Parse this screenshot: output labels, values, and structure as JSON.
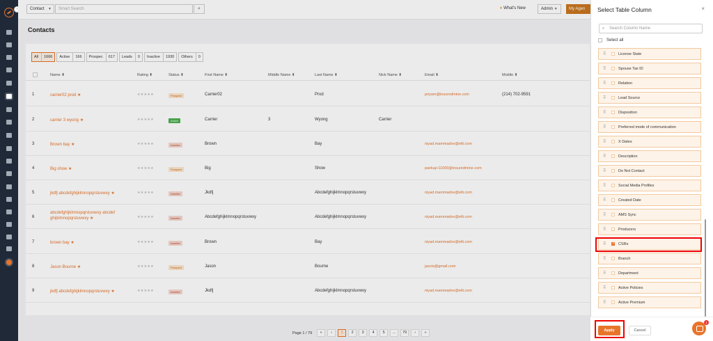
{
  "topbar": {
    "entity_select": "Contact",
    "search_placeholder": "Smart Search",
    "whats_new": "What's New",
    "role_select": "Admin",
    "agency_button": "My Agen"
  },
  "page": {
    "title": "Contacts"
  },
  "filters": [
    {
      "label": "All",
      "count": "1666"
    },
    {
      "label": "Active",
      "count": "166"
    },
    {
      "label": "Prospec",
      "count": "617"
    },
    {
      "label": "Leads",
      "count": "0"
    },
    {
      "label": "Inactive",
      "count": "1930"
    },
    {
      "label": "Others",
      "count": "0"
    }
  ],
  "table": {
    "headers": {
      "name": "Name ⬍",
      "rating": "Rating ⬍",
      "status": "Status ⬍",
      "first": "First Name ⬍",
      "middle": "Middle Name ⬍",
      "last": "Last Name ⬍",
      "nick": "Nick Name ⬍",
      "email": "Email ⬍",
      "mobile": "Mobile ⬍"
    },
    "rows": [
      {
        "num": "1",
        "name": "carrier02 prod",
        "rating": "★★★★★",
        "status": "Prospect",
        "first": "Carrier02",
        "middle": "",
        "last": "Prod",
        "nick": "",
        "email": "priyam@insuredmine.com",
        "mobile": "(214) 702-9591"
      },
      {
        "num": "2",
        "name": "carrier 3 wyong",
        "rating": "★★★★★",
        "status": "Active",
        "first": "Carrier",
        "middle": "3",
        "last": "Wyong",
        "nick": "Carrier",
        "email": "",
        "mobile": ""
      },
      {
        "num": "3",
        "name": "Brown bay",
        "rating": "★★★★★",
        "status": "Inactive",
        "first": "Brown",
        "middle": "",
        "last": "Bay",
        "nick": "",
        "email": "niyad.mammadov@elti.com",
        "mobile": ""
      },
      {
        "num": "4",
        "name": "Big show",
        "rating": "★★★★★",
        "status": "Prospect",
        "first": "Big",
        "middle": "",
        "last": "Show",
        "nick": "",
        "email": "pankaj+11000@insuredmine.com",
        "mobile": ""
      },
      {
        "num": "5",
        "name": "jkdfj abcdefghijklmnopqrstuvwxy",
        "rating": "★★★★★",
        "status": "Inactive",
        "first": "Jkdfj",
        "middle": "",
        "last": "Abcdefghijklmnopqrstuvwxy",
        "nick": "",
        "email": "niyad.mammadov@elti.com",
        "mobile": ""
      },
      {
        "num": "6",
        "name": "abcdefghijklmnopqrstuvwxy abcdef ghijklmnopqrstuvwxy",
        "rating": "★★★★★",
        "status": "Inactive",
        "first": "Abcdefghijklmnopqrstuvwxy",
        "middle": "",
        "last": "Abcdefghijklmnopqrstuvwxy",
        "nick": "",
        "email": "niyad.mammadov@elti.com",
        "mobile": ""
      },
      {
        "num": "7",
        "name": "brown bay",
        "rating": "★★★★★",
        "status": "Inactive",
        "first": "Brown",
        "middle": "",
        "last": "Bay",
        "nick": "",
        "email": "niyad.mammadov@elti.com",
        "mobile": ""
      },
      {
        "num": "8",
        "name": "Jason Bourne",
        "rating": "★★★★★",
        "status": "Prospect",
        "first": "Jason",
        "middle": "",
        "last": "Bourne",
        "nick": "",
        "email": "jasvis@gmail.com",
        "mobile": ""
      },
      {
        "num": "9",
        "name": "jkdfj abcdefghijklmnopqrstuvwxy",
        "rating": "★★★★★",
        "status": "Inactive",
        "first": "Jkdfj",
        "middle": "",
        "last": "Abcdefghijklmnopqrstuvwxy",
        "nick": "",
        "email": "niyad.mammadov@elti.com",
        "mobile": ""
      }
    ]
  },
  "pagination": {
    "label": "Page 1 / 79",
    "first": "«",
    "prev": "‹",
    "pages": [
      "1",
      "2",
      "3",
      "4",
      "5",
      "...",
      "79"
    ],
    "next": "›",
    "last": "»"
  },
  "panel": {
    "title": "Select Table Column",
    "close": "×",
    "search_placeholder": "Search Column Name",
    "select_all": "Select all",
    "columns": [
      {
        "label": "License State",
        "checked": false
      },
      {
        "label": "Spouse Tax ID",
        "checked": false
      },
      {
        "label": "Relation",
        "checked": false
      },
      {
        "label": "Lead Source",
        "checked": false
      },
      {
        "label": "Disposition",
        "checked": false
      },
      {
        "label": "Preferred mode of communication",
        "checked": false
      },
      {
        "label": "X Dates",
        "checked": false
      },
      {
        "label": "Description",
        "checked": false
      },
      {
        "label": "Do Not Contact",
        "checked": false
      },
      {
        "label": "Social Media Profiles",
        "checked": false
      },
      {
        "label": "Created Date",
        "checked": false
      },
      {
        "label": "AMS Sync",
        "checked": false
      },
      {
        "label": "Producers",
        "checked": false
      },
      {
        "label": "CSRs",
        "checked": true
      },
      {
        "label": "Branch",
        "checked": false
      },
      {
        "label": "Department",
        "checked": false
      },
      {
        "label": "Active Policies",
        "checked": false
      },
      {
        "label": "Active Premium",
        "checked": false
      }
    ],
    "apply": "Apply",
    "cancel": "Cancel"
  },
  "chat": {
    "badge": "1"
  },
  "colors": {
    "accent": "#e8742a",
    "sidebar": "#1f2937",
    "highlight": "#ee0000"
  }
}
